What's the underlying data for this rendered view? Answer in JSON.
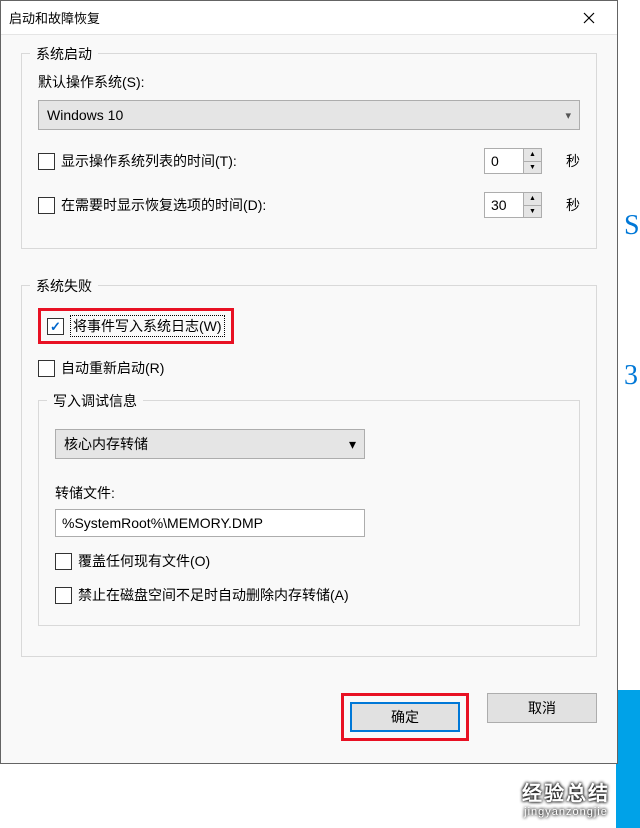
{
  "dialog": {
    "title": "启动和故障恢复"
  },
  "system_startup": {
    "legend": "系统启动",
    "default_os_label": "默认操作系统(S):",
    "default_os_value": "Windows 10",
    "show_os_list": {
      "checked": false,
      "label": "显示操作系统列表的时间(T):",
      "value": "0",
      "unit": "秒"
    },
    "show_recovery": {
      "checked": false,
      "label": "在需要时显示恢复选项的时间(D):",
      "value": "30",
      "unit": "秒"
    }
  },
  "system_failure": {
    "legend": "系统失败",
    "write_event_log": {
      "checked": true,
      "label": "将事件写入系统日志(W)"
    },
    "auto_restart": {
      "checked": false,
      "label": "自动重新启动(R)"
    },
    "debug_info": {
      "legend": "写入调试信息",
      "type_value": "核心内存转储",
      "dump_file_label": "转储文件:",
      "dump_file_value": "%SystemRoot%\\MEMORY.DMP",
      "overwrite": {
        "checked": false,
        "label": "覆盖任何现有文件(O)"
      },
      "disable_auto_delete": {
        "checked": false,
        "label": "禁止在磁盘空间不足时自动删除内存转储(A)"
      }
    }
  },
  "buttons": {
    "ok": "确定",
    "cancel": "取消"
  },
  "watermark": {
    "line1": "经验总结",
    "line2": "jingyanzongjie"
  },
  "bg_chars": {
    "c1": "S",
    "c2": "3"
  }
}
